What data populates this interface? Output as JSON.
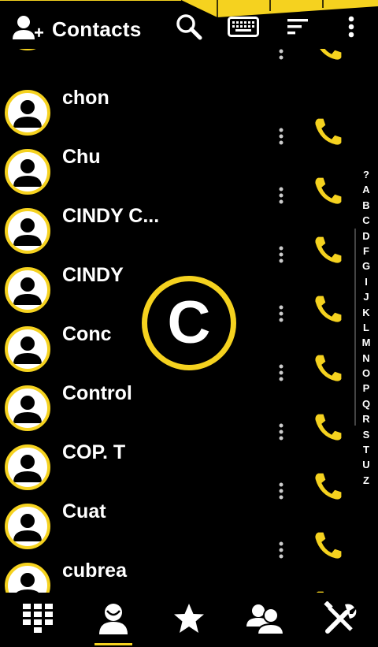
{
  "header": {
    "title": "Contacts",
    "accent_color": "#f5d21f",
    "icons": [
      "add-contact-icon",
      "search-icon",
      "keyboard-icon",
      "sort-icon",
      "overflow-menu-icon"
    ]
  },
  "contacts": [
    {
      "name": ""
    },
    {
      "name": "chon"
    },
    {
      "name": "Chu"
    },
    {
      "name": "CINDY C..."
    },
    {
      "name": "CINDY"
    },
    {
      "name": "Conc"
    },
    {
      "name": "Control"
    },
    {
      "name": "COP. T"
    },
    {
      "name": "Cuat"
    },
    {
      "name": "cubrea"
    }
  ],
  "alphabet_index": [
    "?",
    "A",
    "B",
    "C",
    "D",
    "F",
    "G",
    "I",
    "J",
    "K",
    "L",
    "M",
    "N",
    "O",
    "P",
    "Q",
    "R",
    "S",
    "T",
    "U",
    "Z"
  ],
  "current_letter": "C",
  "bottom_nav": [
    {
      "icon": "dialpad-icon"
    },
    {
      "icon": "contacts-icon",
      "selected": true
    },
    {
      "icon": "favorites-star-icon"
    },
    {
      "icon": "groups-icon"
    },
    {
      "icon": "settings-tools-icon"
    }
  ]
}
